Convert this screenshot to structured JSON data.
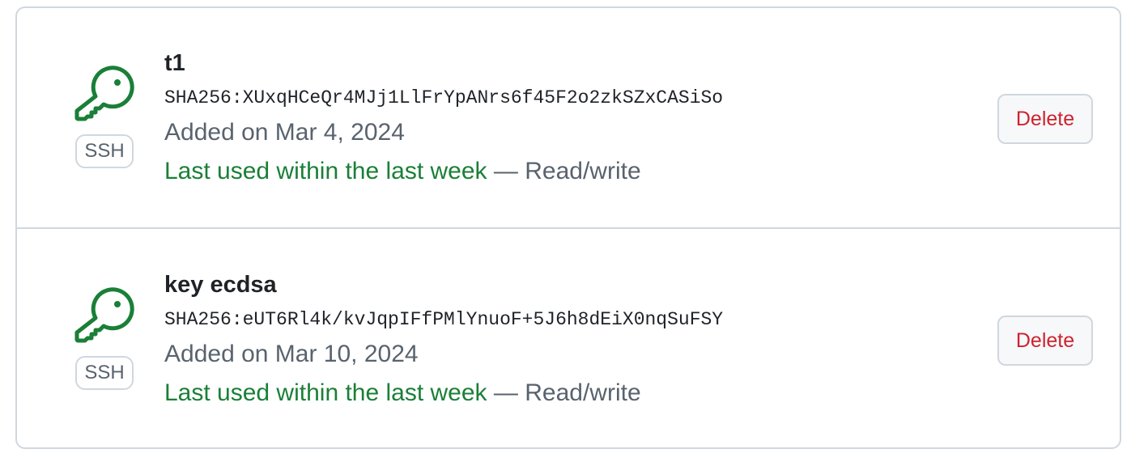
{
  "keys": [
    {
      "title": "t1",
      "fingerprint": "SHA256:XUxqHCeQr4MJj1LlFrYpANrs6f45F2o2zkSZxCASiSo",
      "added": "Added on Mar 4, 2024",
      "last_used": "Last used within the last week",
      "access": " — Read/write",
      "type_badge": "SSH",
      "delete_label": "Delete",
      "icon": "key-icon"
    },
    {
      "title": "key ecdsa",
      "fingerprint": "SHA256:eUT6Rl4k/kvJqpIFfPMlYnuoF+5J6h8dEiX0nqSuFSY",
      "added": "Added on Mar 10, 2024",
      "last_used": "Last used within the last week",
      "access": " — Read/write",
      "type_badge": "SSH",
      "delete_label": "Delete",
      "icon": "key-icon"
    }
  ],
  "colors": {
    "key_icon": "#1a7f37",
    "last_used": "#1a7f37",
    "delete_text": "#cf222e",
    "border": "#d0d7de",
    "muted_text": "#59636e"
  }
}
